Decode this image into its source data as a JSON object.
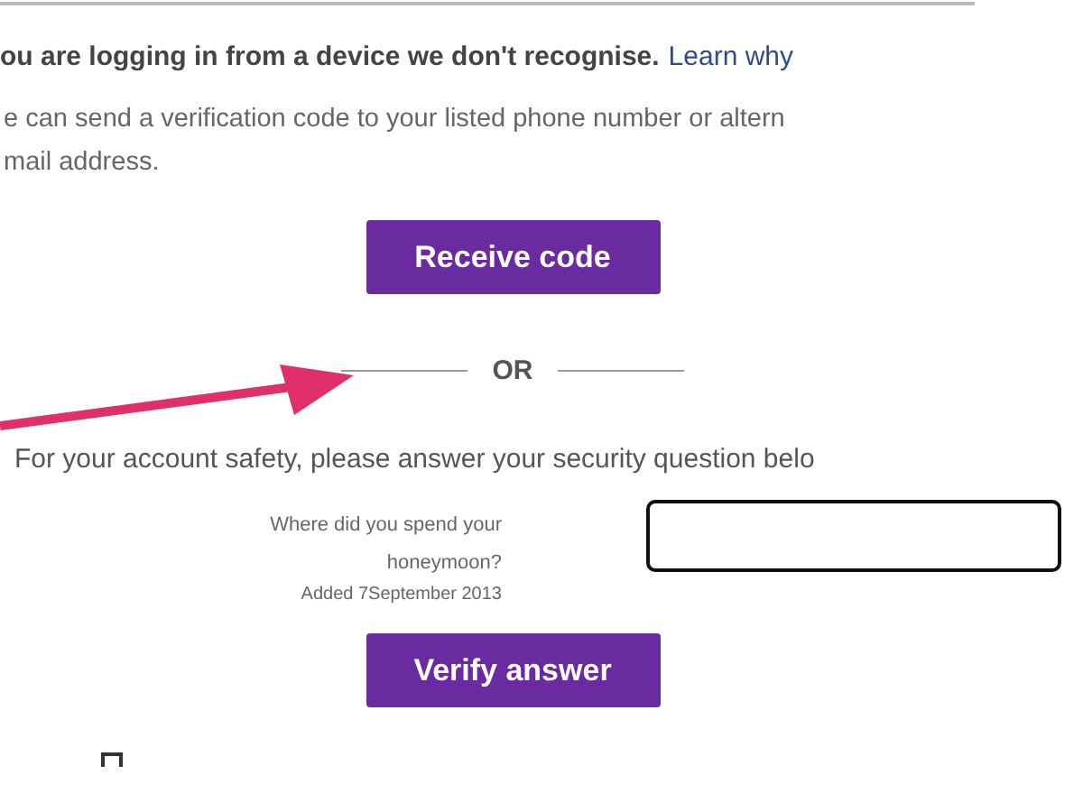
{
  "notice": {
    "heading": "ou are logging in from a device we don't recognise.",
    "link": "Learn why"
  },
  "description": "e can send a verification code to your listed phone number or altern",
  "description_line_2": "mail address.",
  "receive_button": "Receive code",
  "divider": "OR",
  "instruction": "For your account safety, please answer your security question belo",
  "question": {
    "text": "Where did you spend your honeymoon?",
    "added": "Added 7September 2013"
  },
  "verify_button": "Verify answer"
}
